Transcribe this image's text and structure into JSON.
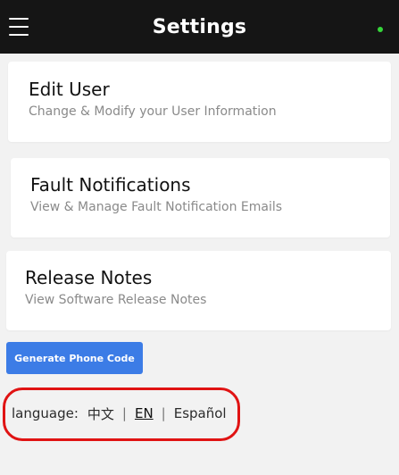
{
  "header": {
    "title": "Settings",
    "menu_icon": "hamburger-menu-icon",
    "status_color": "#35d63a"
  },
  "cards": [
    {
      "title": "Edit User",
      "subtitle": "Change & Modify your User Information"
    },
    {
      "title": "Fault Notifications",
      "subtitle": "View & Manage Fault Notification Emails"
    },
    {
      "title": "Release Notes",
      "subtitle": "View Software Release Notes"
    }
  ],
  "generate_button": {
    "label": "Generate Phone Code",
    "color": "#3c7ce6"
  },
  "language": {
    "label": "language:",
    "options": [
      "中文",
      "EN",
      "Español"
    ],
    "selected": "EN",
    "separator": "|"
  },
  "annotation": {
    "highlight_color": "#e01313"
  }
}
